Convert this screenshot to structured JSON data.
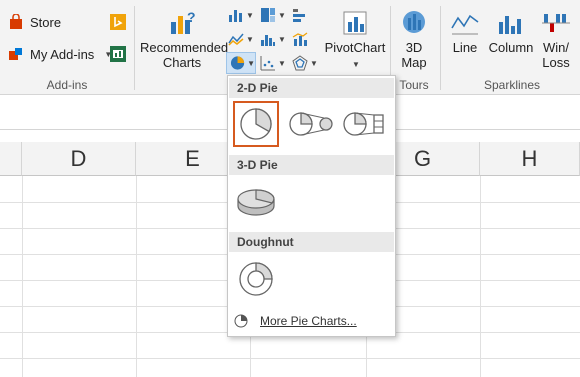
{
  "ribbon": {
    "addins": {
      "store_label": "Store",
      "my_addins_label": "My Add-ins",
      "group_label": "Add-ins"
    },
    "recommended_charts": {
      "line1": "Recommended",
      "line2": "Charts"
    },
    "pivotchart_label": "PivotChart",
    "map3d": {
      "line1": "3D",
      "line2": "Map",
      "group_label": "Tours"
    },
    "sparklines": {
      "line_label": "Line",
      "column_label": "Column",
      "winloss_line1": "Win/",
      "winloss_line2": "Loss",
      "group_label": "Sparklines"
    }
  },
  "sheet": {
    "columns": [
      "D",
      "E",
      "G",
      "H"
    ]
  },
  "pie_menu": {
    "section_2d": "2-D Pie",
    "section_3d": "3-D Pie",
    "section_doughnut": "Doughnut",
    "more_label": "More Pie Charts..."
  },
  "colors": {
    "selected_border": "#d65a1f",
    "bing_yellow": "#f0a30a",
    "store_red": "#d83b01",
    "green_icon": "#217346"
  }
}
